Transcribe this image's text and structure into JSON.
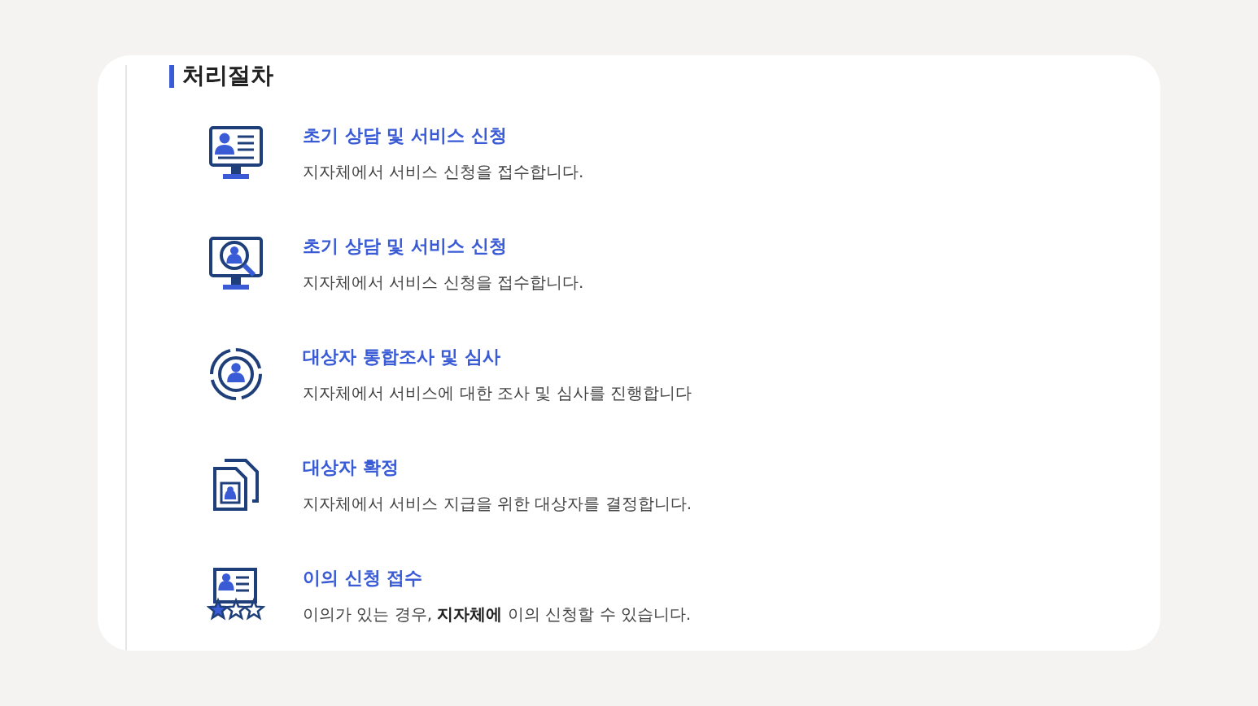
{
  "section": {
    "title": "처리절차"
  },
  "steps": [
    {
      "kind": "monitor-profile",
      "title": "초기 상담 및 서비스 신청",
      "description": "지자체에서 서비스 신청을 접수합니다."
    },
    {
      "kind": "monitor-search",
      "title": "초기 상담 및 서비스 신청",
      "description": "지자체에서 서비스 신청을 접수합니다."
    },
    {
      "kind": "target",
      "title": "대상자 통합조사 및 심사",
      "description": "지자체에서 서비스에 대한 조사 및 심사를 진행합니다"
    },
    {
      "kind": "documents",
      "title": "대상자 확정",
      "description": "지자체에서 서비스 지급을 위한 대상자를 결정합니다."
    },
    {
      "kind": "rating",
      "title": "이의 신청 접수",
      "description": "이의가 있는 경우, **지자체에** 이의 신청할 수 있습니다."
    }
  ]
}
